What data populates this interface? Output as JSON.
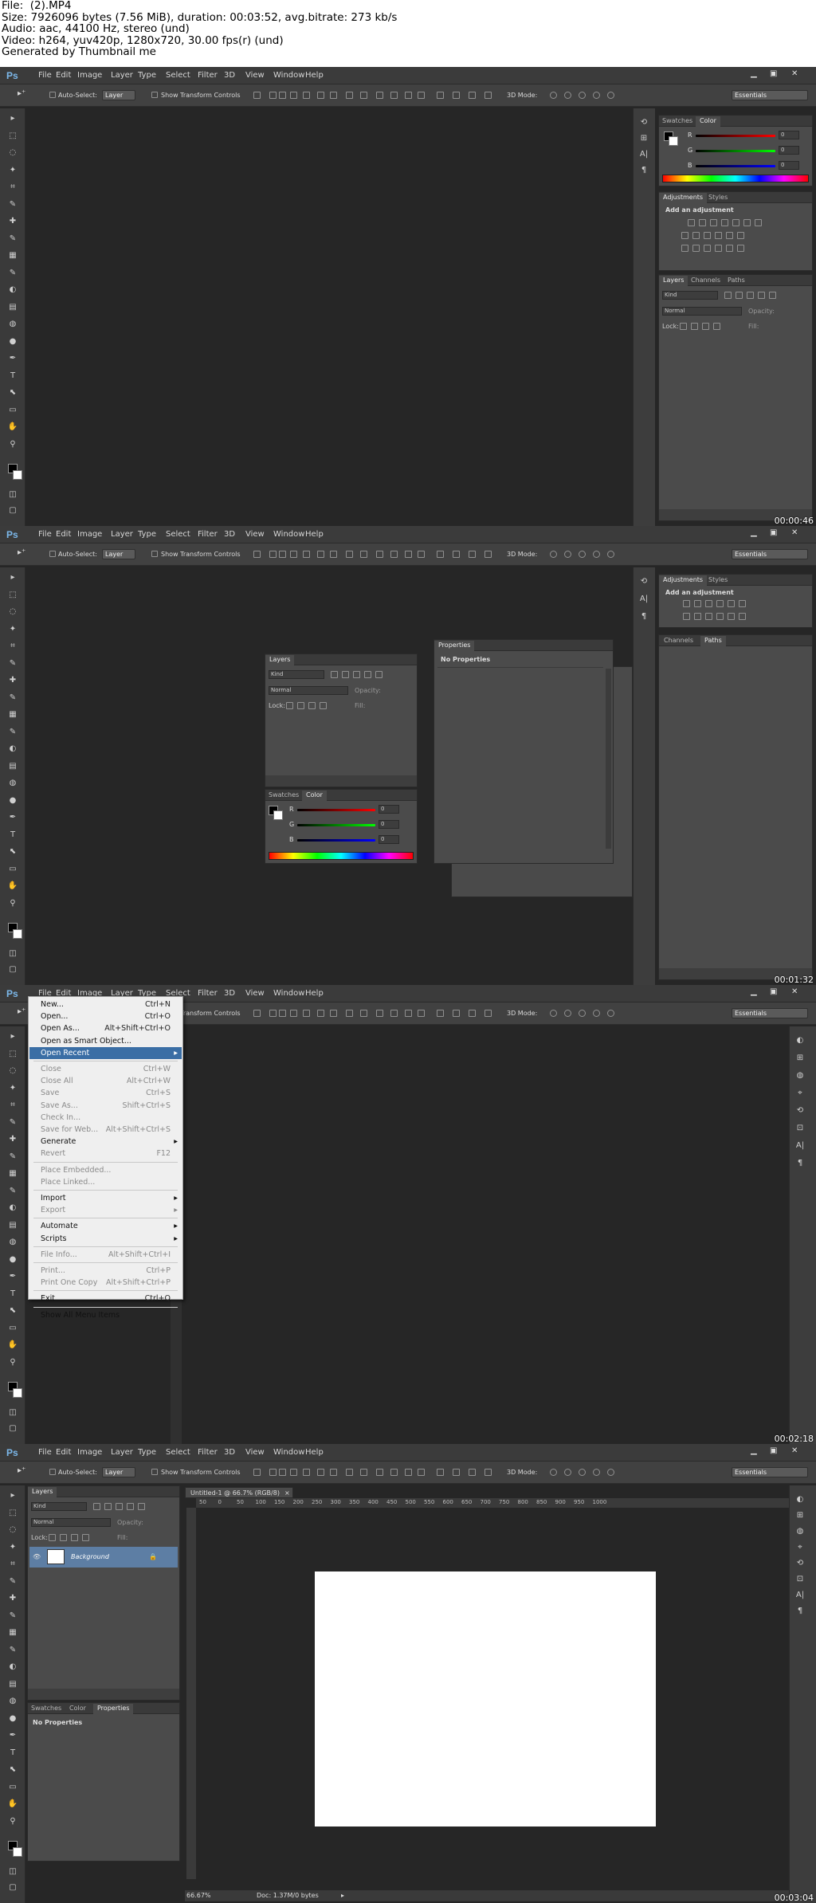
{
  "header": {
    "lines": [
      "File:  (2).MP4",
      "Size: 7926096 bytes (7.56 MiB), duration: 00:03:52, avg.bitrate: 273 kb/s",
      "Audio: aac, 44100 Hz, stereo (und)",
      "Video: h264, yuv420p, 1280x720, 30.00 fps(r) (und)",
      "Generated by Thumbnail me"
    ]
  },
  "app": {
    "logo": "Ps",
    "menus": [
      "File",
      "Edit",
      "Image",
      "Layer",
      "Type",
      "Select",
      "Filter",
      "3D",
      "View",
      "Window",
      "Help"
    ],
    "auto_select": "Auto-Select:",
    "layer_select": "Layer",
    "show_transform": "Show Transform Controls",
    "mode_3d": "3D Mode:",
    "workspace": "Essentials"
  },
  "timestamps": [
    "00:00:46",
    "00:01:32",
    "00:02:18",
    "00:03:04"
  ],
  "panels": {
    "swatches": "Swatches",
    "color": "Color",
    "adjustments": "Adjustments",
    "styles": "Styles",
    "add_adjustment": "Add an adjustment",
    "layers": "Layers",
    "channels": "Channels",
    "paths": "Paths",
    "kind": "Kind",
    "blend": "Normal",
    "opacity": "Opacity:",
    "lock": "Lock:",
    "fill": "Fill:",
    "properties": "Properties",
    "no_properties": "No Properties",
    "r": "R",
    "g": "G",
    "b": "B",
    "zero": "0",
    "background_layer": "Background"
  },
  "file_menu": [
    {
      "label": "New...",
      "shortcut": "Ctrl+N",
      "state": "normal"
    },
    {
      "label": "Open...",
      "shortcut": "Ctrl+O",
      "state": "normal"
    },
    {
      "label": "Open As...",
      "shortcut": "Alt+Shift+Ctrl+O",
      "state": "normal"
    },
    {
      "label": "Open as Smart Object...",
      "shortcut": "",
      "state": "normal"
    },
    {
      "label": "Open Recent",
      "shortcut": "",
      "state": "highlight",
      "submenu": true
    },
    {
      "sep": true
    },
    {
      "label": "Close",
      "shortcut": "Ctrl+W",
      "state": "disabled"
    },
    {
      "label": "Close All",
      "shortcut": "Alt+Ctrl+W",
      "state": "disabled"
    },
    {
      "label": "Save",
      "shortcut": "Ctrl+S",
      "state": "disabled"
    },
    {
      "label": "Save As...",
      "shortcut": "Shift+Ctrl+S",
      "state": "disabled"
    },
    {
      "label": "Check In...",
      "shortcut": "",
      "state": "disabled"
    },
    {
      "label": "Save for Web...",
      "shortcut": "Alt+Shift+Ctrl+S",
      "state": "disabled"
    },
    {
      "label": "Generate",
      "shortcut": "",
      "state": "normal",
      "submenu": true
    },
    {
      "label": "Revert",
      "shortcut": "F12",
      "state": "disabled"
    },
    {
      "sep": true
    },
    {
      "label": "Place Embedded...",
      "shortcut": "",
      "state": "disabled"
    },
    {
      "label": "Place Linked...",
      "shortcut": "",
      "state": "disabled"
    },
    {
      "sep": true
    },
    {
      "label": "Import",
      "shortcut": "",
      "state": "normal",
      "submenu": true
    },
    {
      "label": "Export",
      "shortcut": "",
      "state": "disabled",
      "submenu": true
    },
    {
      "sep": true
    },
    {
      "label": "Automate",
      "shortcut": "",
      "state": "normal",
      "submenu": true
    },
    {
      "label": "Scripts",
      "shortcut": "",
      "state": "normal",
      "submenu": true
    },
    {
      "sep": true
    },
    {
      "label": "File Info...",
      "shortcut": "Alt+Shift+Ctrl+I",
      "state": "disabled"
    },
    {
      "sep": true
    },
    {
      "label": "Print...",
      "shortcut": "Ctrl+P",
      "state": "disabled"
    },
    {
      "label": "Print One Copy",
      "shortcut": "Alt+Shift+Ctrl+P",
      "state": "disabled"
    },
    {
      "sep": true
    },
    {
      "label": "Exit",
      "shortcut": "Ctrl+Q",
      "state": "normal"
    },
    {
      "sep": true
    },
    {
      "label": "Show All Menu Items",
      "shortcut": "",
      "state": "normal"
    }
  ],
  "document": {
    "tab": "Untitled-1 @ 66.7% (RGB/8)",
    "zoom": "66.67%",
    "doc_info": "Doc: 1.37M/0 bytes",
    "ruler_ticks": [
      "50",
      "0",
      "50",
      "100",
      "150",
      "200",
      "250",
      "300",
      "350",
      "400",
      "450",
      "500",
      "550",
      "600",
      "650",
      "700",
      "750",
      "800",
      "850",
      "900",
      "950",
      "1000"
    ]
  },
  "colors": {
    "bg": "#262626",
    "menubar": "#3b3b3b",
    "panel": "#4b4b4b",
    "highlight": "#3a6ea5",
    "layer_selected": "#5d7ea4"
  }
}
